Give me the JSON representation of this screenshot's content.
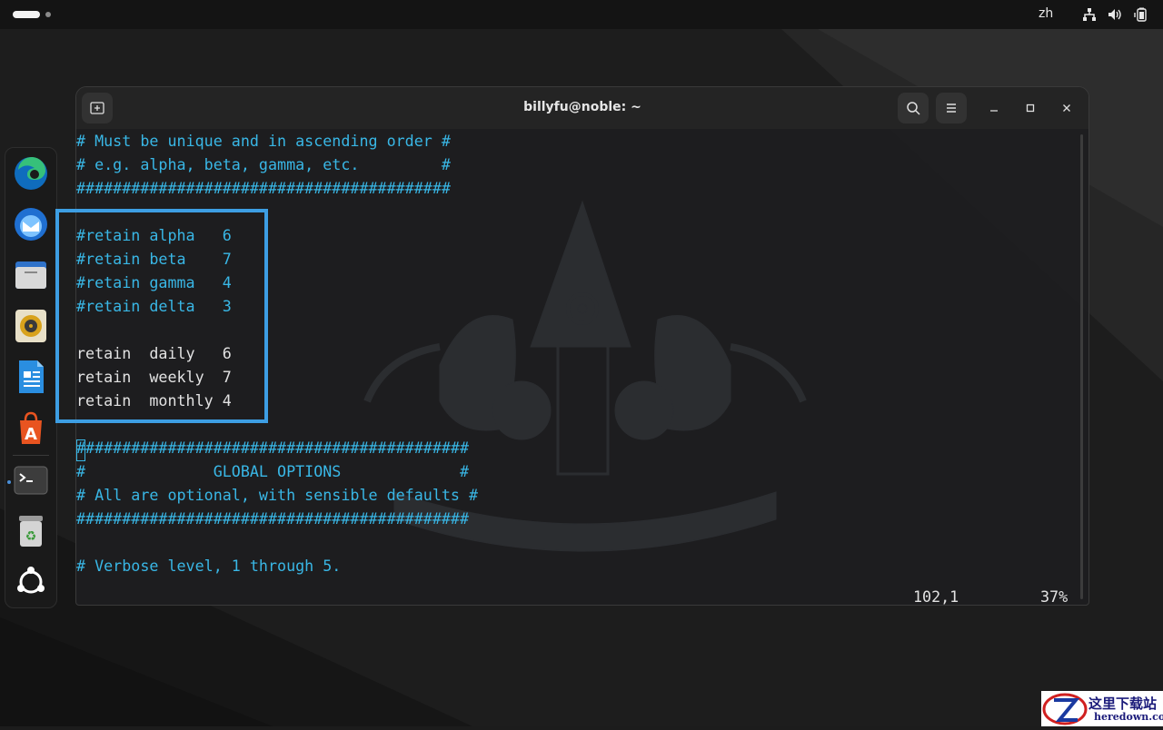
{
  "topbar": {
    "lang": "zh",
    "tray_icons": [
      "network-icon",
      "volume-icon",
      "battery-icon"
    ]
  },
  "dock": {
    "apps": [
      {
        "name": "edge-icon",
        "label": "Microsoft Edge"
      },
      {
        "name": "thunderbird-icon",
        "label": "Thunderbird"
      },
      {
        "name": "files-icon",
        "label": "Files"
      },
      {
        "name": "rhythmbox-icon",
        "label": "Rhythmbox"
      },
      {
        "name": "writer-icon",
        "label": "LibreOffice Writer"
      },
      {
        "name": "app-center-icon",
        "label": "App Center"
      },
      {
        "name": "terminal-icon",
        "label": "Terminal"
      },
      {
        "name": "trash-icon",
        "label": "Trash"
      },
      {
        "name": "ubuntu-icon",
        "label": "Show Apps"
      }
    ]
  },
  "terminal": {
    "title": "billyfu@noble: ~",
    "lines": [
      "# Must be unique and in ascending order #",
      "# e.g. alpha, beta, gamma, etc.         #",
      "#########################################",
      "",
      "#retain alpha   6",
      "#retain beta    7",
      "#retain gamma   4",
      "#retain delta   3",
      "",
      "retain  daily   6",
      "retain  weekly  7",
      "retain  monthly 4",
      "",
      "###########################################",
      "#              GLOBAL OPTIONS             #",
      "# All are optional, with sensible defaults #",
      "###########################################",
      "",
      "",
      "# Verbose level, 1 through 5."
    ],
    "status_position": "102,1",
    "status_percent": "37%"
  },
  "colors": {
    "comment": "#39b7e6",
    "text": "#e2e2e2",
    "highlight": "#3d9ee3",
    "background": "#1e1e20"
  },
  "site_mark": {
    "cn": "这里下载站",
    "en": "heredown.com"
  }
}
